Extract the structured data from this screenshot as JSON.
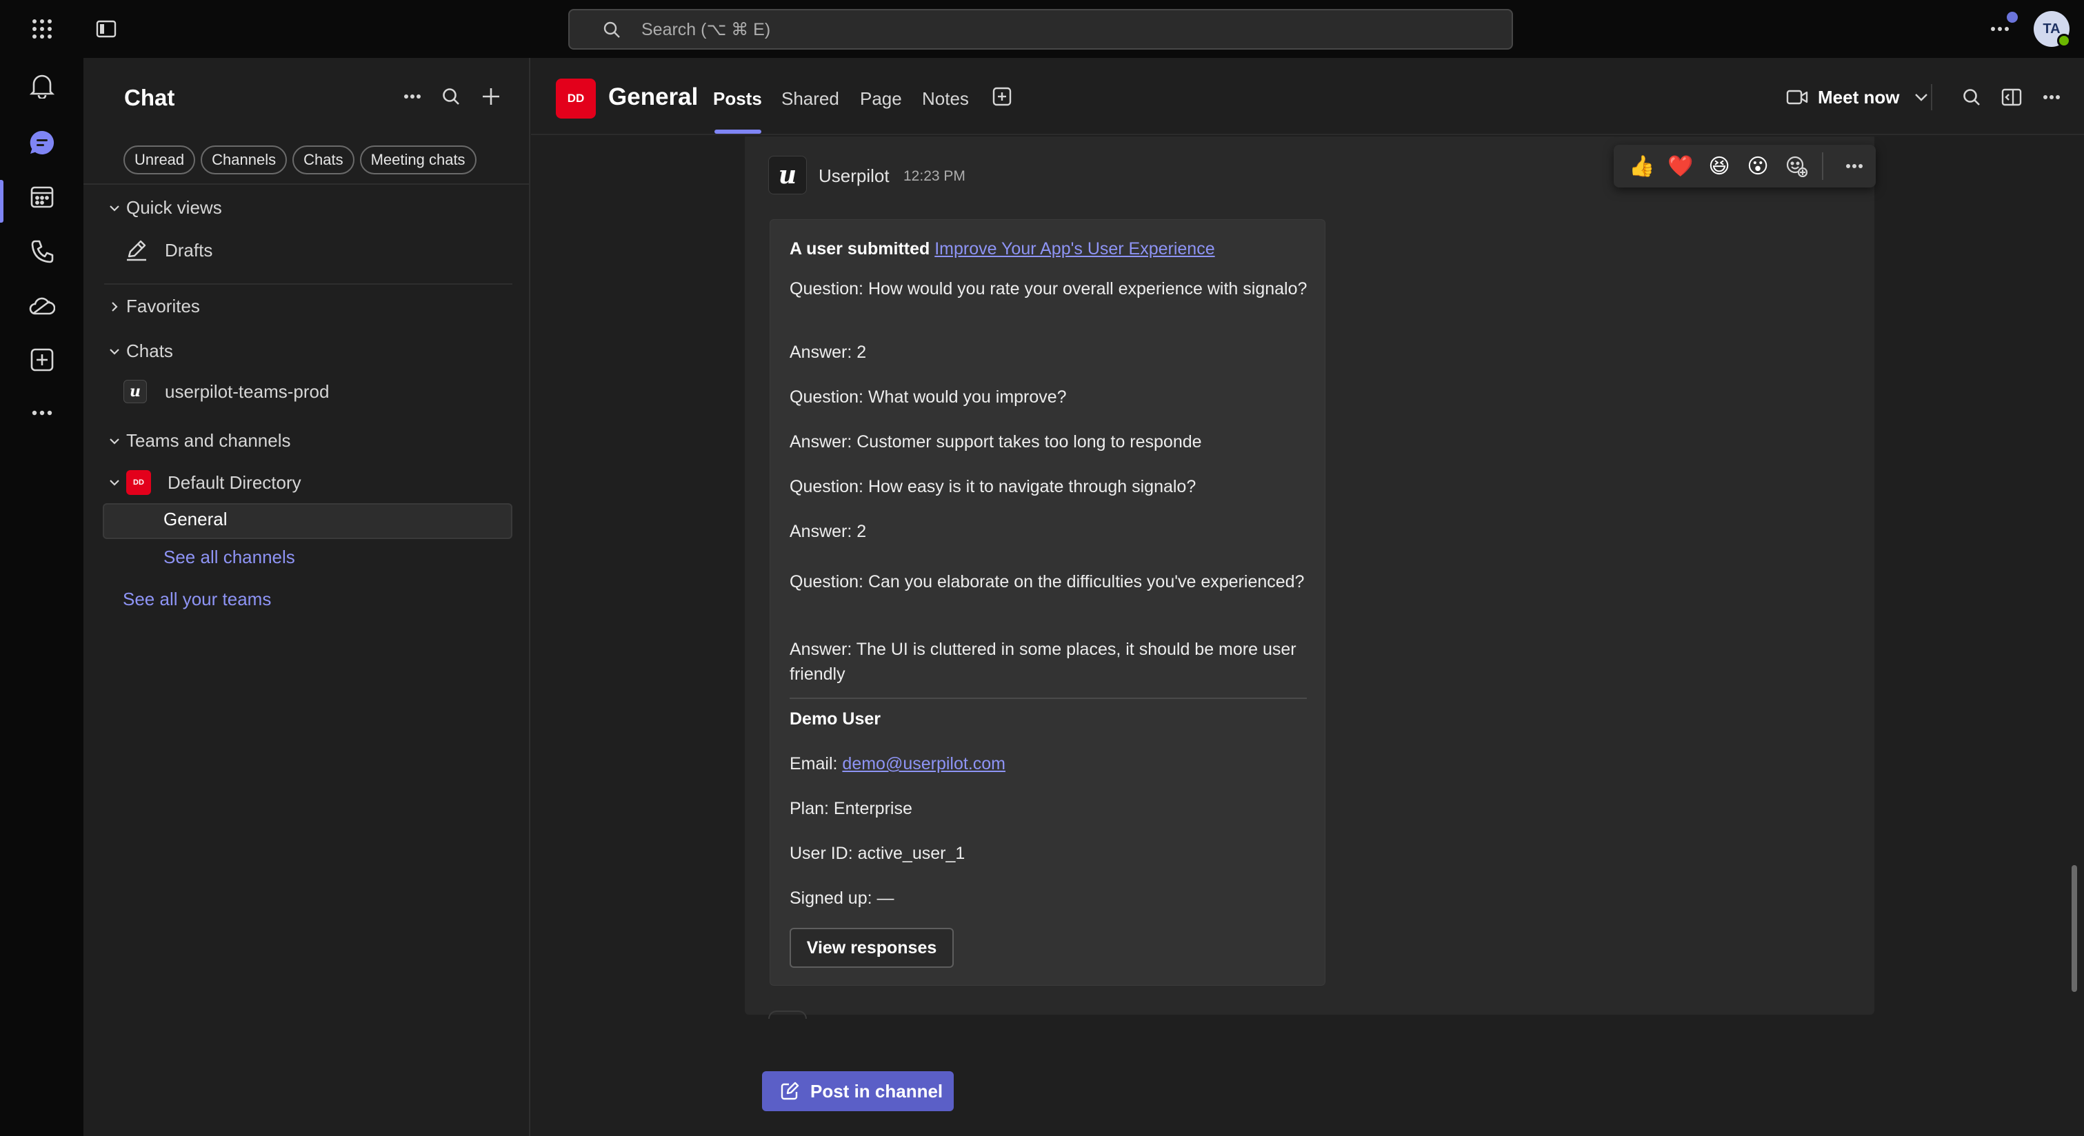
{
  "topbar": {
    "search_placeholder": "Search (⌥ ⌘ E)",
    "avatar_initials": "TA"
  },
  "rail": {
    "items": [
      "activity",
      "chat",
      "calendar",
      "calls",
      "onedrive",
      "apps",
      "more"
    ],
    "active": "chat"
  },
  "sidebar": {
    "title": "Chat",
    "filters": [
      "Unread",
      "Channels",
      "Chats",
      "Meeting chats"
    ],
    "quick_views_label": "Quick views",
    "drafts_label": "Drafts",
    "favorites_label": "Favorites",
    "chats_label": "Chats",
    "chat_item": "userpilot-teams-prod",
    "teams_label": "Teams and channels",
    "team_name": "Default Directory",
    "team_initials": "DD",
    "channel_general": "General",
    "see_all_channels": "See all channels",
    "see_all_teams": "See all your teams"
  },
  "channel": {
    "initials": "DD",
    "name": "General",
    "tabs": [
      "Posts",
      "Shared",
      "Page",
      "Notes"
    ],
    "active_tab": "Posts",
    "meet_now": "Meet now"
  },
  "post": {
    "author_initial": "u",
    "author": "Userpilot",
    "time": "12:23 PM",
    "reactions": [
      "👍",
      "❤️",
      "😆",
      "😮"
    ],
    "card": {
      "intro": "A user submitted",
      "survey_link": "Improve Your App's User Experience",
      "q1": "Question: How would you rate your overall experience with signalo?",
      "a1": "Answer: 2",
      "q2": "Question: What would you improve?",
      "a2": "Answer: Customer support takes too long to responde",
      "q3": "Question: How easy is it to navigate through signalo?",
      "a3": "Answer: 2",
      "q4": "Question: Can you elaborate on the difficulties you've experienced?",
      "a4": "Answer: The UI is cluttered in some places, it should be more user friendly",
      "user_name": "Demo User",
      "email_label": "Email:",
      "email": "demo@userpilot.com",
      "plan": "Plan: Enterprise",
      "user_id": "User ID: active_user_1",
      "signed_up": "Signed up: —",
      "view_button": "View responses"
    }
  },
  "compose": {
    "post_in_channel": "Post in channel"
  },
  "colors": {
    "accent": "#7f85f5",
    "button": "#5b5fc7",
    "team_tile": "#e3001b",
    "background": "#1f1f1f"
  }
}
